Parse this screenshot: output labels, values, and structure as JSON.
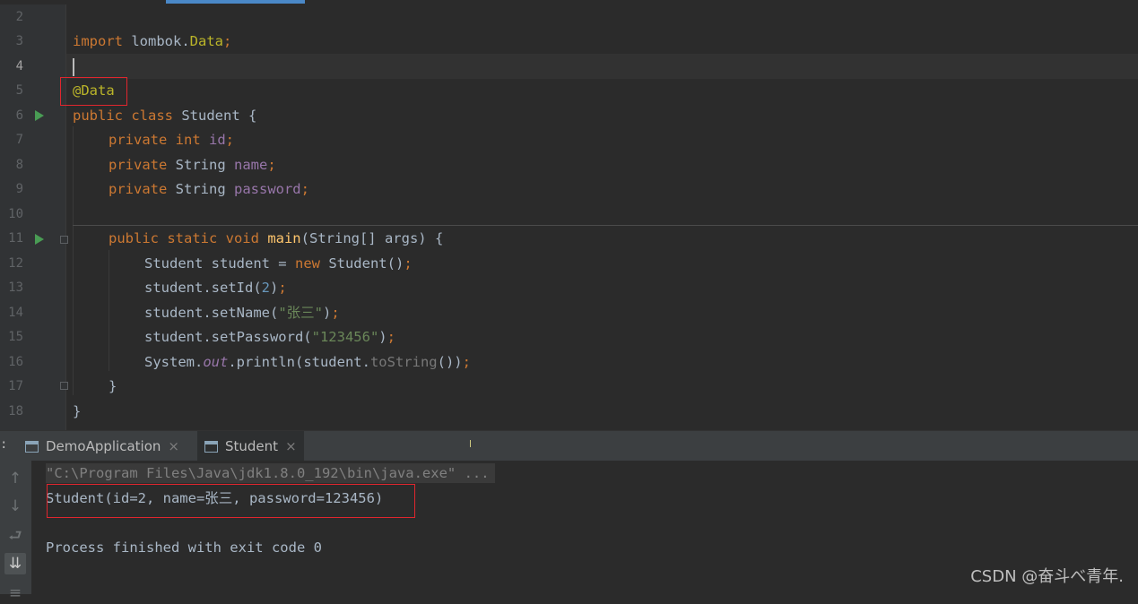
{
  "editor": {
    "line_numbers": [
      "2",
      "3",
      "4",
      "5",
      "6",
      "7",
      "8",
      "9",
      "10",
      "11",
      "12",
      "13",
      "14",
      "15",
      "16",
      "17",
      "18"
    ],
    "current_line": "4",
    "code": {
      "l3_import": "import",
      "l3_pkg": " lombok.",
      "l3_cls": "Data",
      "l3_semi": ";",
      "l5_ann": "@Data",
      "l6_public": "public",
      "l6_class": " class",
      "l6_name": " Student {",
      "l7_private": "private",
      "l7_type": " int",
      "l7_field": " id",
      "l7_semi": ";",
      "l8_private": "private",
      "l8_type": " String",
      "l8_field": " name",
      "l8_semi": ";",
      "l9_private": "private",
      "l9_type": " String",
      "l9_field": " password",
      "l9_semi": ";",
      "l11_mods": "public static void",
      "l11_main": " main",
      "l11_params": "(String[] args) {",
      "l12_decl": "Student student = ",
      "l12_new": "new",
      "l12_ctor": " Student()",
      "l12_semi": ";",
      "l13_call": "student.setId(",
      "l13_num": "2",
      "l13_close": ")",
      "l13_semi": ";",
      "l14_call": "student.setName(",
      "l14_str": "\"张三\"",
      "l14_close": ")",
      "l14_semi": ";",
      "l15_call": "student.setPassword(",
      "l15_str": "\"123456\"",
      "l15_close": ")",
      "l15_semi": ";",
      "l16_sys": "System.",
      "l16_out": "out",
      "l16_println": ".println(student.",
      "l16_tostr": "toString",
      "l16_close": "())",
      "l16_semi": ";",
      "l17_brace": "}",
      "l18_brace": "}"
    }
  },
  "run_panel": {
    "tabs": [
      {
        "label": "DemoApplication",
        "close": "×"
      },
      {
        "label": "Student",
        "close": "×"
      }
    ],
    "colon": ":",
    "console": {
      "command": "\"C:\\Program Files\\Java\\jdk1.8.0_192\\bin\\java.exe\" ...",
      "output": "Student(id=2, name=张三, password=123456)",
      "exit": "Process finished with exit code 0"
    },
    "toolbar_icons": [
      "arrow-up-icon",
      "arrow-down-icon",
      "soft-wrap-icon",
      "scroll-to-end-icon",
      "print-icon"
    ]
  },
  "watermark": "CSDN @奋斗べ青年.",
  "colors": {
    "background": "#2b2b2b",
    "gutter": "#313335",
    "keyword": "#cc7832",
    "annotation": "#bbb529",
    "field": "#9876aa",
    "string": "#6a8759",
    "number": "#6897bb",
    "method": "#ffc66d",
    "highlight_box": "#e0262e",
    "run_icon": "#499c54"
  }
}
